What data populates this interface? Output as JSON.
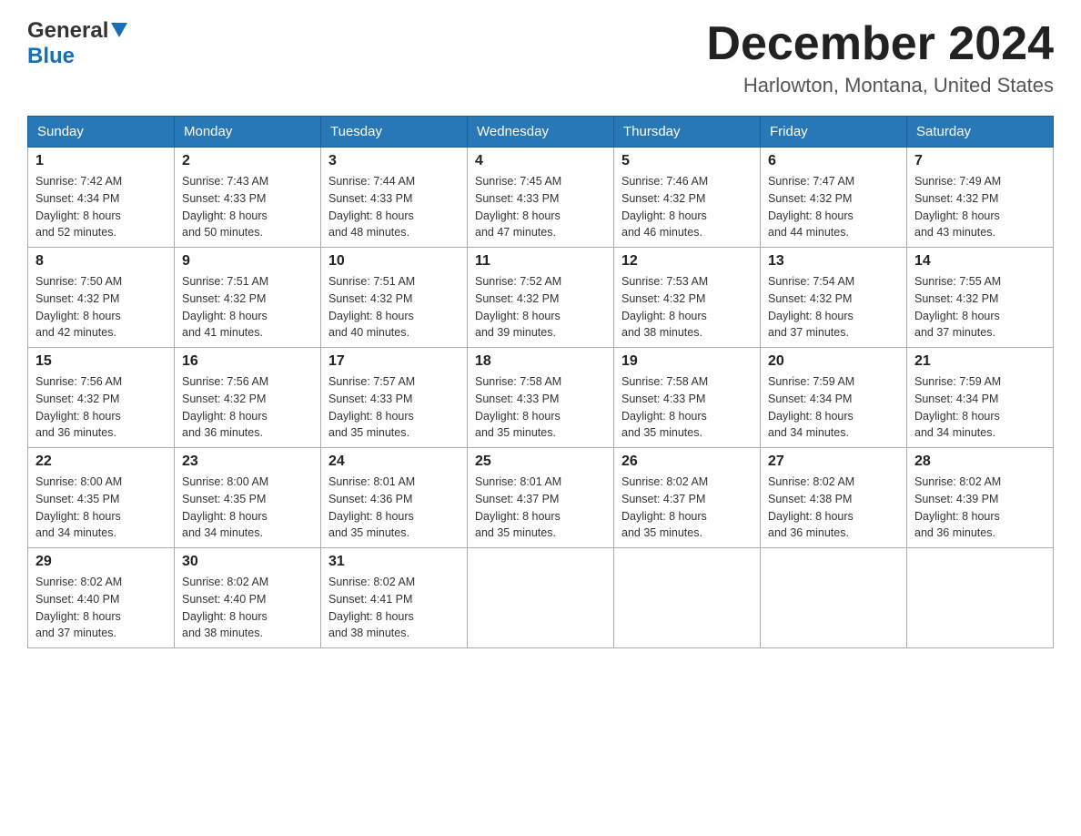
{
  "header": {
    "logo_general": "General",
    "logo_blue": "Blue",
    "month_title": "December 2024",
    "location": "Harlowton, Montana, United States"
  },
  "days_of_week": [
    "Sunday",
    "Monday",
    "Tuesday",
    "Wednesday",
    "Thursday",
    "Friday",
    "Saturday"
  ],
  "weeks": [
    [
      {
        "day": "1",
        "sunrise": "7:42 AM",
        "sunset": "4:34 PM",
        "daylight": "8 hours and 52 minutes."
      },
      {
        "day": "2",
        "sunrise": "7:43 AM",
        "sunset": "4:33 PM",
        "daylight": "8 hours and 50 minutes."
      },
      {
        "day": "3",
        "sunrise": "7:44 AM",
        "sunset": "4:33 PM",
        "daylight": "8 hours and 48 minutes."
      },
      {
        "day": "4",
        "sunrise": "7:45 AM",
        "sunset": "4:33 PM",
        "daylight": "8 hours and 47 minutes."
      },
      {
        "day": "5",
        "sunrise": "7:46 AM",
        "sunset": "4:32 PM",
        "daylight": "8 hours and 46 minutes."
      },
      {
        "day": "6",
        "sunrise": "7:47 AM",
        "sunset": "4:32 PM",
        "daylight": "8 hours and 44 minutes."
      },
      {
        "day": "7",
        "sunrise": "7:49 AM",
        "sunset": "4:32 PM",
        "daylight": "8 hours and 43 minutes."
      }
    ],
    [
      {
        "day": "8",
        "sunrise": "7:50 AM",
        "sunset": "4:32 PM",
        "daylight": "8 hours and 42 minutes."
      },
      {
        "day": "9",
        "sunrise": "7:51 AM",
        "sunset": "4:32 PM",
        "daylight": "8 hours and 41 minutes."
      },
      {
        "day": "10",
        "sunrise": "7:51 AM",
        "sunset": "4:32 PM",
        "daylight": "8 hours and 40 minutes."
      },
      {
        "day": "11",
        "sunrise": "7:52 AM",
        "sunset": "4:32 PM",
        "daylight": "8 hours and 39 minutes."
      },
      {
        "day": "12",
        "sunrise": "7:53 AM",
        "sunset": "4:32 PM",
        "daylight": "8 hours and 38 minutes."
      },
      {
        "day": "13",
        "sunrise": "7:54 AM",
        "sunset": "4:32 PM",
        "daylight": "8 hours and 37 minutes."
      },
      {
        "day": "14",
        "sunrise": "7:55 AM",
        "sunset": "4:32 PM",
        "daylight": "8 hours and 37 minutes."
      }
    ],
    [
      {
        "day": "15",
        "sunrise": "7:56 AM",
        "sunset": "4:32 PM",
        "daylight": "8 hours and 36 minutes."
      },
      {
        "day": "16",
        "sunrise": "7:56 AM",
        "sunset": "4:32 PM",
        "daylight": "8 hours and 36 minutes."
      },
      {
        "day": "17",
        "sunrise": "7:57 AM",
        "sunset": "4:33 PM",
        "daylight": "8 hours and 35 minutes."
      },
      {
        "day": "18",
        "sunrise": "7:58 AM",
        "sunset": "4:33 PM",
        "daylight": "8 hours and 35 minutes."
      },
      {
        "day": "19",
        "sunrise": "7:58 AM",
        "sunset": "4:33 PM",
        "daylight": "8 hours and 35 minutes."
      },
      {
        "day": "20",
        "sunrise": "7:59 AM",
        "sunset": "4:34 PM",
        "daylight": "8 hours and 34 minutes."
      },
      {
        "day": "21",
        "sunrise": "7:59 AM",
        "sunset": "4:34 PM",
        "daylight": "8 hours and 34 minutes."
      }
    ],
    [
      {
        "day": "22",
        "sunrise": "8:00 AM",
        "sunset": "4:35 PM",
        "daylight": "8 hours and 34 minutes."
      },
      {
        "day": "23",
        "sunrise": "8:00 AM",
        "sunset": "4:35 PM",
        "daylight": "8 hours and 34 minutes."
      },
      {
        "day": "24",
        "sunrise": "8:01 AM",
        "sunset": "4:36 PM",
        "daylight": "8 hours and 35 minutes."
      },
      {
        "day": "25",
        "sunrise": "8:01 AM",
        "sunset": "4:37 PM",
        "daylight": "8 hours and 35 minutes."
      },
      {
        "day": "26",
        "sunrise": "8:02 AM",
        "sunset": "4:37 PM",
        "daylight": "8 hours and 35 minutes."
      },
      {
        "day": "27",
        "sunrise": "8:02 AM",
        "sunset": "4:38 PM",
        "daylight": "8 hours and 36 minutes."
      },
      {
        "day": "28",
        "sunrise": "8:02 AM",
        "sunset": "4:39 PM",
        "daylight": "8 hours and 36 minutes."
      }
    ],
    [
      {
        "day": "29",
        "sunrise": "8:02 AM",
        "sunset": "4:40 PM",
        "daylight": "8 hours and 37 minutes."
      },
      {
        "day": "30",
        "sunrise": "8:02 AM",
        "sunset": "4:40 PM",
        "daylight": "8 hours and 38 minutes."
      },
      {
        "day": "31",
        "sunrise": "8:02 AM",
        "sunset": "4:41 PM",
        "daylight": "8 hours and 38 minutes."
      },
      null,
      null,
      null,
      null
    ]
  ],
  "labels": {
    "sunrise": "Sunrise:",
    "sunset": "Sunset:",
    "daylight": "Daylight:"
  }
}
